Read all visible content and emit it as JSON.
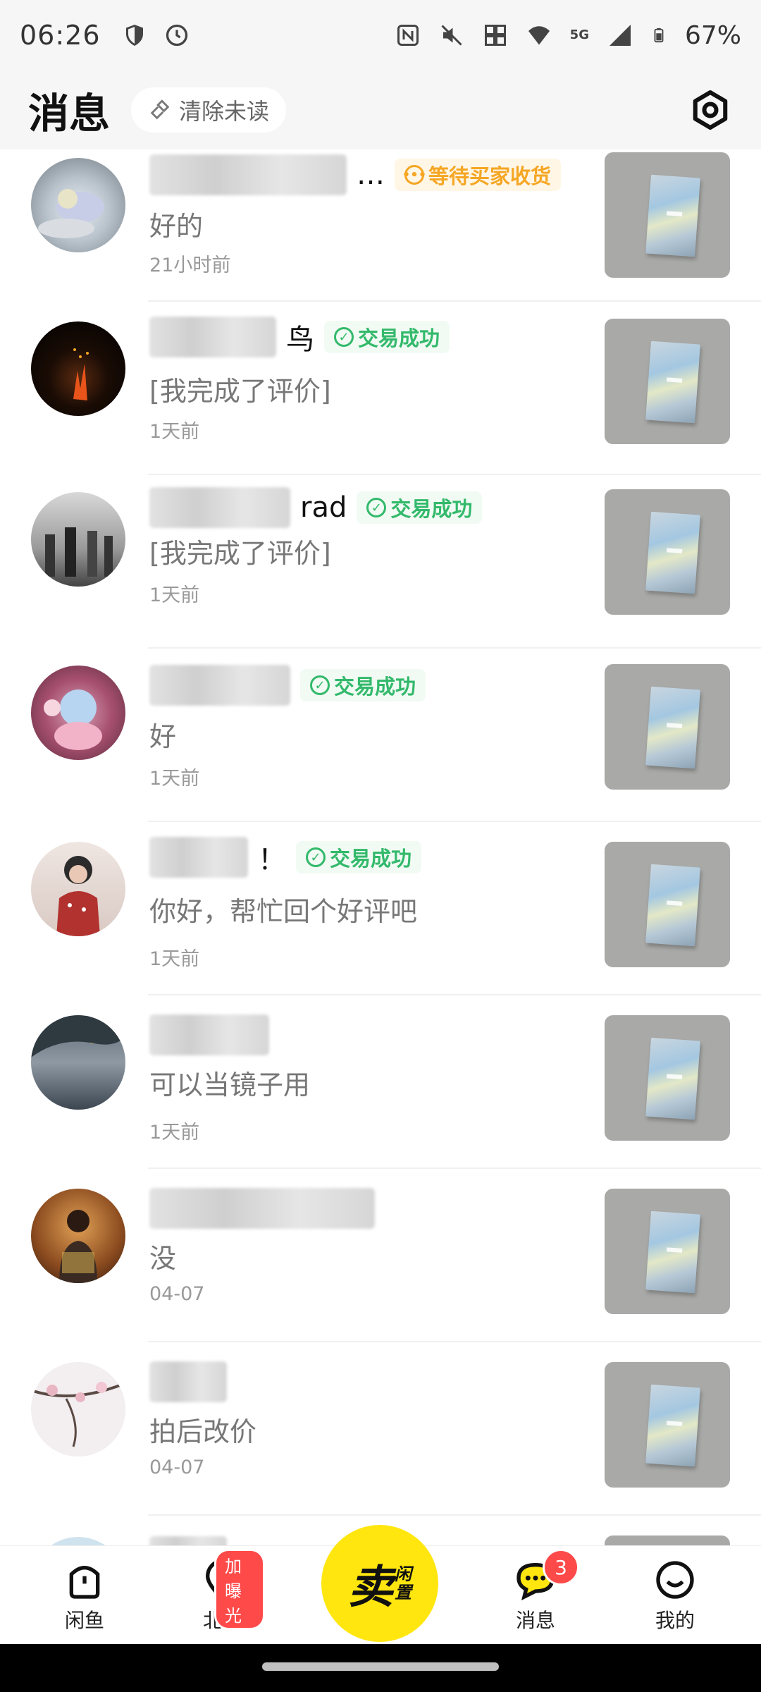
{
  "status_bar": {
    "time": "06:26",
    "battery": "67%",
    "network": "5G"
  },
  "header": {
    "title": "消息",
    "clear_unread": "清除未读"
  },
  "conversations": [
    {
      "name_suffix": "…",
      "badge": "等待买家收货",
      "badge_type": "wait",
      "message": "好的",
      "time": "21小时前"
    },
    {
      "name_suffix": "鸟",
      "badge": "交易成功",
      "badge_type": "success",
      "message": "[我完成了评价]",
      "time": "1天前"
    },
    {
      "name_suffix": "rad",
      "badge": "交易成功",
      "badge_type": "success",
      "message": "[我完成了评价]",
      "time": "1天前"
    },
    {
      "name_suffix": "",
      "badge": "交易成功",
      "badge_type": "success",
      "message": "好",
      "time": "1天前"
    },
    {
      "name_suffix": "！",
      "badge": "交易成功",
      "badge_type": "success",
      "message": "你好，帮忙回个好评吧",
      "time": "1天前"
    },
    {
      "name_suffix": "",
      "badge": "",
      "badge_type": "",
      "message": "可以当镜子用",
      "time": "1天前"
    },
    {
      "name_suffix": "",
      "badge": "",
      "badge_type": "",
      "message": "没",
      "time": "04-07"
    },
    {
      "name_suffix": "",
      "badge": "",
      "badge_type": "",
      "message": "拍后改价",
      "time": "04-07"
    }
  ],
  "bottom_nav": {
    "home": "闲鱼",
    "city": "北京",
    "city_badge": "加曝光",
    "sell_main": "卖",
    "sell_sub_1": "闲",
    "sell_sub_2": "置",
    "messages": "消息",
    "messages_count": "3",
    "mine": "我的"
  },
  "colors": {
    "accent_yellow": "#ffe60f",
    "success_green": "#33b96b",
    "wait_orange": "#f5a623",
    "badge_red": "#ff4a4a"
  }
}
